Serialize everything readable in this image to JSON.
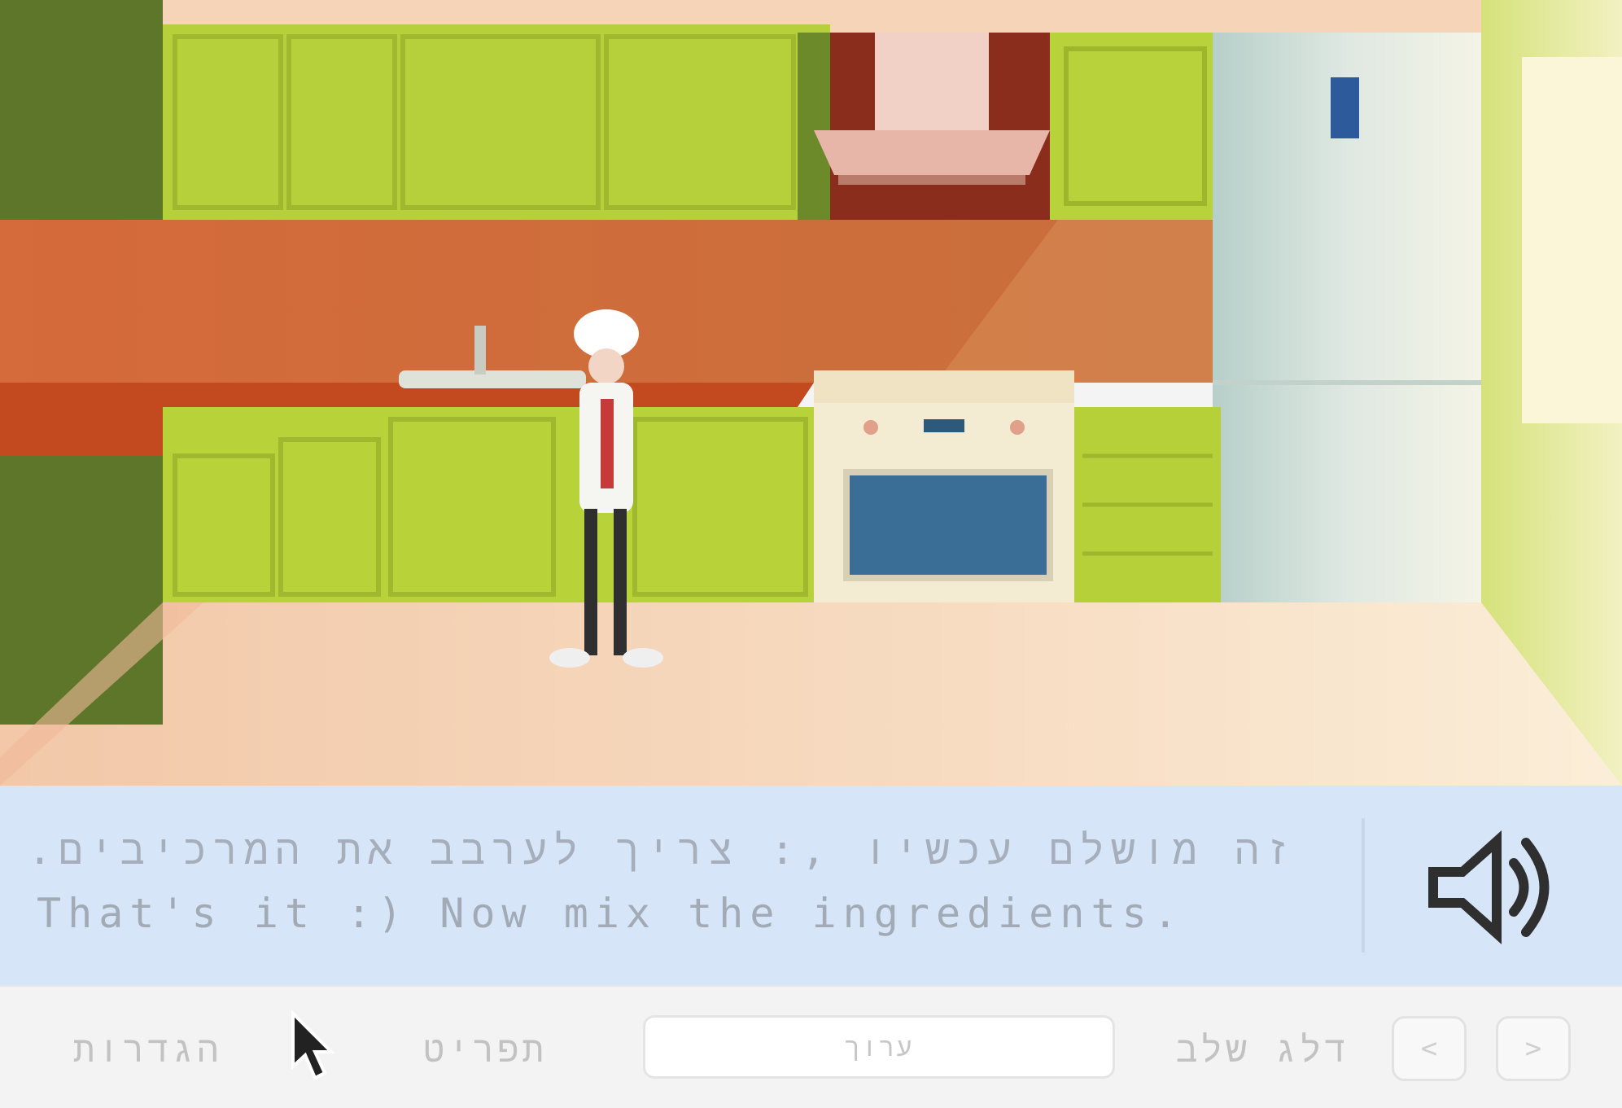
{
  "dialog": {
    "line_hebrew": "זה מושלם עכשיו ,: צריך לערבב את המרכיבים.",
    "line_english": "That's it :) Now mix the ingredients.",
    "speaker_icon": "speaker-volume-icon"
  },
  "controls": {
    "item_1": "הגדרות",
    "item_2": "תפריט",
    "input_text": "ערוך",
    "item_3": "דלג שלב",
    "prev_label": "<",
    "next_label": ">"
  },
  "colors": {
    "dialog_bg": "#d6e6f8",
    "cabinet_green": "#b8d23a",
    "backsplash": "#c8643a",
    "floor": "#f6d9bf"
  }
}
